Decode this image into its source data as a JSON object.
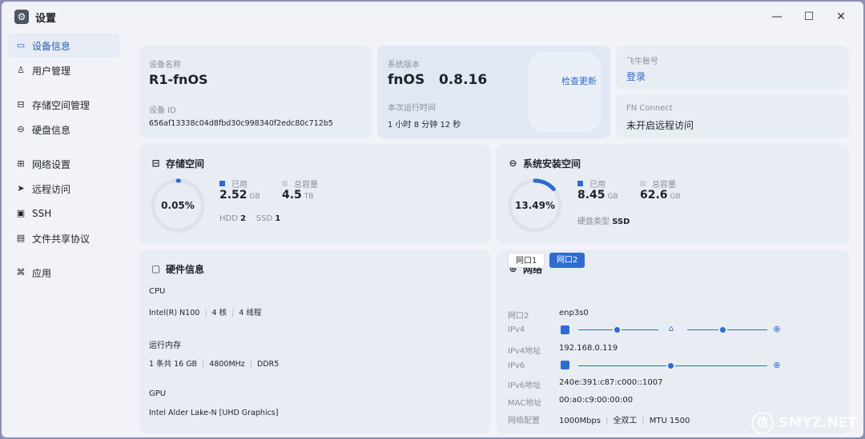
{
  "window": {
    "title": "设置"
  },
  "sidebar": {
    "items": [
      {
        "label": "设备信息",
        "icon": "device-icon"
      },
      {
        "label": "用户管理",
        "icon": "user-icon"
      },
      {
        "label": "存储空间管理",
        "icon": "storage-icon"
      },
      {
        "label": "硬盘信息",
        "icon": "disk-icon"
      },
      {
        "label": "网络设置",
        "icon": "network-icon"
      },
      {
        "label": "远程访问",
        "icon": "remote-icon"
      },
      {
        "label": "SSH",
        "icon": "ssh-icon"
      },
      {
        "label": "文件共享协议",
        "icon": "file-share-icon"
      },
      {
        "label": "应用",
        "icon": "apps-icon"
      }
    ]
  },
  "device": {
    "name_label": "设备名称",
    "name": "R1-fnOS",
    "id_label": "设备 ID",
    "id": "656af13338c04d8fbd30c998340f2edc80c712b5"
  },
  "system": {
    "version_label": "系统版本",
    "os": "fnOS",
    "version": "0.8.16",
    "update_link": "检查更新",
    "uptime_label": "本次运行时间",
    "uptime": "1 小时 8 分钟 12 秒"
  },
  "account": {
    "label": "飞牛账号",
    "login": "登录"
  },
  "fnconnect": {
    "label": "FN Connect",
    "status": "未开启远程访问"
  },
  "storage": {
    "title": "存储空间",
    "percent": "0.05%",
    "percent_value": 0.0005,
    "used_label": "已用",
    "used": "2.52",
    "used_unit": "GB",
    "total_label": "总容量",
    "total": "4.5",
    "total_unit": "TB",
    "hdd_label": "HDD",
    "hdd": "2",
    "ssd_label": "SSD",
    "ssd": "1"
  },
  "sysdisk": {
    "title": "系统安装空间",
    "percent": "13.49%",
    "percent_value": 0.1349,
    "used_label": "已用",
    "used": "8.45",
    "used_unit": "GB",
    "total_label": "总容量",
    "total": "62.6",
    "total_unit": "GB",
    "type_label": "硬盘类型",
    "type": "SSD"
  },
  "hardware": {
    "title": "硬件信息",
    "cpu_label": "CPU",
    "cpu": [
      "Intel(R) N100",
      "4 核",
      "4 线程"
    ],
    "mem_label": "运行内存",
    "mem": [
      "1 条共 16 GB",
      "4800MHz",
      "DDR5"
    ],
    "gpu_label": "GPU",
    "gpu": "Intel Alder Lake-N [UHD Graphics]"
  },
  "network": {
    "title": "网络",
    "tabs": [
      "网口1",
      "网口2"
    ],
    "active_tab": 1,
    "rows": [
      {
        "label": "网口2",
        "value": "enp3s0"
      },
      {
        "label": "IPv4",
        "value": ""
      },
      {
        "label": "IPv4地址",
        "value": "192.168.0.119"
      },
      {
        "label": "IPv6",
        "value": ""
      },
      {
        "label": "IPv6地址",
        "value": "240e:391:c87:c000::1007"
      },
      {
        "label": "MAC地址",
        "value": "00:a0:c9:00:00:00"
      },
      {
        "label": "网络配置",
        "value": [
          "1000Mbps",
          "全双工",
          "MTU 1500"
        ]
      }
    ]
  },
  "colors": {
    "accent": "#2f6bd0",
    "ring_track": "#dde1e8",
    "total_square": "#cfd4dc"
  },
  "watermark": {
    "text": "SMYZ.NET",
    "glyph": "值"
  }
}
